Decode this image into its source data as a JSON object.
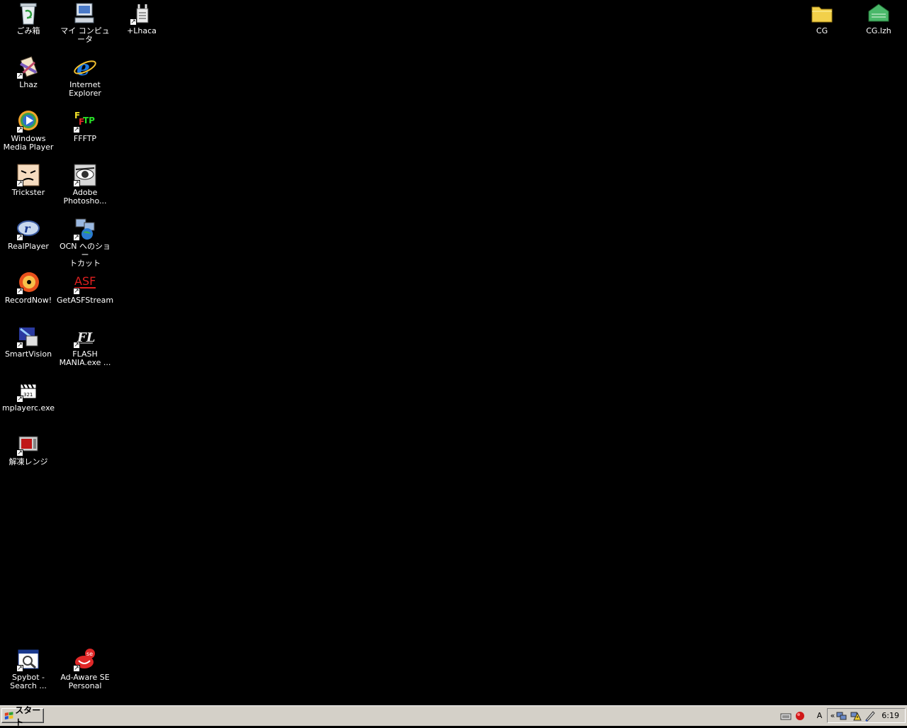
{
  "desktop": {
    "icons": [
      {
        "id": "recycle-bin",
        "label": "ごみ箱",
        "icon": "recycle-bin-icon",
        "shortcut": false
      },
      {
        "id": "my-computer",
        "label": "マイ コンピュータ",
        "icon": "computer-icon",
        "shortcut": false
      },
      {
        "id": "lhaca",
        "label": "+Lhaca",
        "icon": "archive-tool-icon",
        "shortcut": true
      },
      {
        "id": "lhaz",
        "label": "Lhaz",
        "icon": "lhaz-icon",
        "shortcut": true
      },
      {
        "id": "internet-explorer",
        "label": "Internet\nExplorer",
        "icon": "ie-icon",
        "shortcut": false
      },
      {
        "id": "windows-media-player",
        "label": "Windows\nMedia Player",
        "icon": "media-player-icon",
        "shortcut": true
      },
      {
        "id": "ffftp",
        "label": "FFFTP",
        "icon": "ftp-icon",
        "shortcut": true
      },
      {
        "id": "trickster",
        "label": "Trickster",
        "icon": "trickster-face-icon",
        "shortcut": true
      },
      {
        "id": "adobe-photoshop",
        "label": "Adobe\nPhotosho...",
        "icon": "photoshop-eye-icon",
        "shortcut": true
      },
      {
        "id": "realplayer",
        "label": "RealPlayer",
        "icon": "realplayer-icon",
        "shortcut": true
      },
      {
        "id": "ocn-shortcut",
        "label": "OCN へのショー\nトカット",
        "icon": "network-globe-icon",
        "shortcut": true
      },
      {
        "id": "recordnow",
        "label": "RecordNow!",
        "icon": "cd-burn-icon",
        "shortcut": true
      },
      {
        "id": "getasfstream",
        "label": "GetASFStream",
        "icon": "asf-icon",
        "shortcut": true
      },
      {
        "id": "smartvision",
        "label": "SmartVision",
        "icon": "smartvision-icon",
        "shortcut": true
      },
      {
        "id": "flash-mania",
        "label": "FLASH\nMANIA.exe ...",
        "icon": "flash-mania-icon",
        "shortcut": true
      },
      {
        "id": "mplayerc",
        "label": "mplayerc.exe",
        "icon": "clapperboard-icon",
        "shortcut": true
      },
      {
        "id": "kaitou-range",
        "label": "解凍レンジ",
        "icon": "microwave-icon",
        "shortcut": true
      },
      {
        "id": "cg-folder",
        "label": "CG",
        "icon": "folder-icon",
        "shortcut": false
      },
      {
        "id": "cg-lzh",
        "label": "CG.lzh",
        "icon": "lzh-archive-icon",
        "shortcut": false
      },
      {
        "id": "spybot",
        "label": "Spybot -\nSearch ...",
        "icon": "spybot-icon",
        "shortcut": true
      },
      {
        "id": "ad-aware",
        "label": "Ad-Aware SE\nPersonal",
        "icon": "ad-aware-icon",
        "shortcut": true
      }
    ]
  },
  "taskbar": {
    "start_label": "スタート",
    "ime_label": "A",
    "tray_expand": "«",
    "clock": "6:19"
  }
}
